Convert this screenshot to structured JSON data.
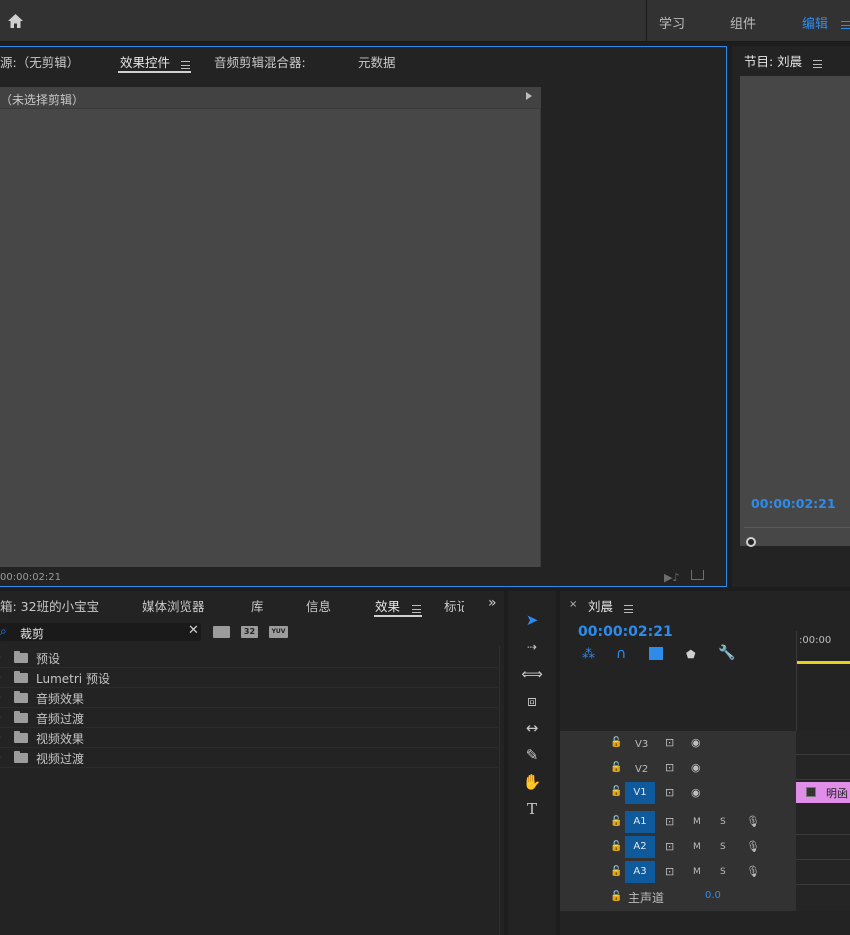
{
  "topbar": {
    "workspaces": [
      "学习",
      "组件",
      "编辑"
    ],
    "active_workspace": "编辑"
  },
  "source_panel": {
    "tabs": [
      "源:（无剪辑）",
      "效果控件",
      "音频剪辑混合器:",
      "元数据"
    ],
    "active_tab": "效果控件",
    "no_clip_label": "（未选择剪辑）",
    "timecode": "00:00:02:21"
  },
  "program_panel": {
    "title": "节目: 刘晨",
    "timecode": "00:00:02:21"
  },
  "project_panel": {
    "tabs": [
      "箱: 32班的小宝宝",
      "媒体浏览器",
      "库",
      "信息",
      "效果",
      "标记"
    ],
    "active_tab": "效果",
    "search_value": "裁剪",
    "icon_badges": [
      "32",
      "YUV"
    ],
    "tree_items": [
      {
        "label": "预设",
        "icon": "preset-folder-icon"
      },
      {
        "label": "Lumetri 预设",
        "icon": "preset-folder-icon"
      },
      {
        "label": "音频效果",
        "icon": "folder-icon"
      },
      {
        "label": "音频过渡",
        "icon": "folder-icon"
      },
      {
        "label": "视频效果",
        "icon": "folder-icon"
      },
      {
        "label": "视频过渡",
        "icon": "folder-icon"
      }
    ]
  },
  "timeline": {
    "sequence_name": "刘晨",
    "timecode": "00:00:02:21",
    "ruler_start": ":00:00",
    "video_tracks": [
      "V3",
      "V2",
      "V1"
    ],
    "audio_tracks": [
      "A1",
      "A2",
      "A3"
    ],
    "audio_flags": [
      "M",
      "S"
    ],
    "master_label": "主声道",
    "master_value": "0.0",
    "clip_label": "明函"
  },
  "colors": {
    "accent_blue": "#2d8ceb",
    "track_blue": "#0e5a9c",
    "playhead_yellow": "#e6d21e",
    "clip_pink": "#e08ee8"
  }
}
